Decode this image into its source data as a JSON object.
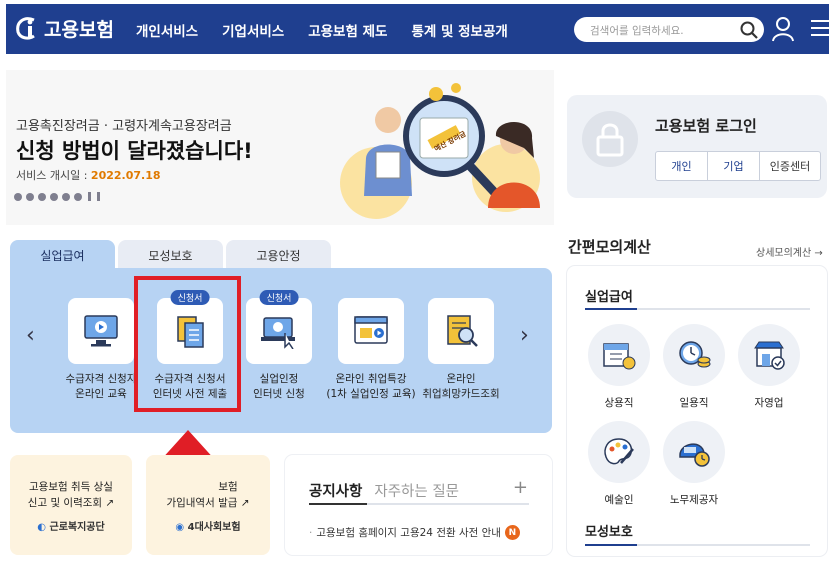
{
  "header": {
    "logo_text": "고용보험",
    "nav": [
      "개인서비스",
      "기업서비스",
      "고용보험 제도",
      "통계 및 정보공개"
    ],
    "search_placeholder": "검색어를 입력하세요.",
    "colors": {
      "bar": "#1f3f8f"
    }
  },
  "banner": {
    "subtitle": "고용촉진장려금 · 고령자계속고용장려금",
    "title": "신청 방법이 달라졌습니다!",
    "date_label": "서비스 개시일 :",
    "date_value": "2022.07.18",
    "art_label": "예산 장려금",
    "dot_count": 6
  },
  "login": {
    "title": "고용보험 로그인",
    "buttons": [
      "개인",
      "기업",
      "인증센터"
    ]
  },
  "service_tabs": {
    "tabs": [
      "실업급여",
      "모성보호",
      "고용안정"
    ],
    "active": 0,
    "items": [
      {
        "line1": "수급자격 신청자",
        "line2": "온라인 교육",
        "badge": ""
      },
      {
        "line1": "수급자격 신청서",
        "line2": "인터넷 사전 제출",
        "badge": "신청서"
      },
      {
        "line1": "실업인정",
        "line2": "인터넷 신청",
        "badge": "신청서"
      },
      {
        "line1": "온라인 취업특강",
        "line2": "(1차 실업인정 교육)",
        "badge": ""
      },
      {
        "line1": "온라인",
        "line2": "취업희망카드조회",
        "badge": ""
      }
    ]
  },
  "cards": [
    {
      "line1": "고용보험 취득 상실",
      "line2": "신고 및 이력조회 ↗",
      "org": "근로복지공단"
    },
    {
      "line1": "보험",
      "line2": "가입내역서 발급 ↗",
      "org": "4대사회보험"
    }
  ],
  "notice": {
    "tabs": [
      "공지사항",
      "자주하는 질문"
    ],
    "plus": "+",
    "item": "고용보험 홈페이지 고용24 전환 사전 안내",
    "badge": "N"
  },
  "calculator": {
    "title": "간편모의계산",
    "more": "상세모의계산 →",
    "section1": "실업급여",
    "jobs": [
      "상용직",
      "일용직",
      "자영업",
      "예술인",
      "노무제공자"
    ],
    "section2": "모성보호"
  },
  "highlight": {
    "color": "#e01e26"
  }
}
